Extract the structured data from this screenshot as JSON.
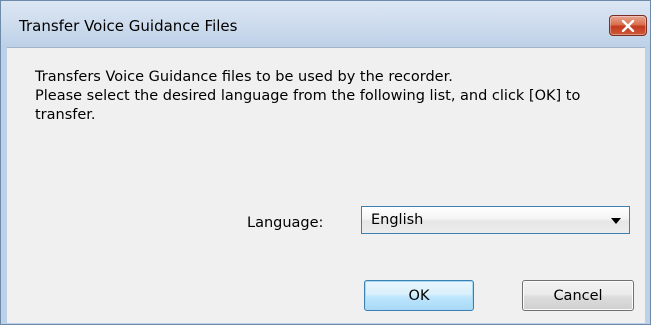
{
  "window": {
    "title": "Transfer Voice Guidance Files",
    "close_icon": "close-icon"
  },
  "description": {
    "lines": [
      "Transfers Voice Guidance files to be used by the recorder.",
      "Please select the desired language from the following list, and click [OK] to",
      "transfer."
    ]
  },
  "language": {
    "label": "Language:",
    "selected": "English",
    "arrow_icon": "chevron-down-icon"
  },
  "buttons": {
    "ok_label": "OK",
    "cancel_label": "Cancel"
  },
  "colors": {
    "close_button": "#c4391f",
    "ok_border": "#3c7fb1",
    "dialog_face": "#f0f0f0",
    "frame": "#bcd0e7"
  }
}
